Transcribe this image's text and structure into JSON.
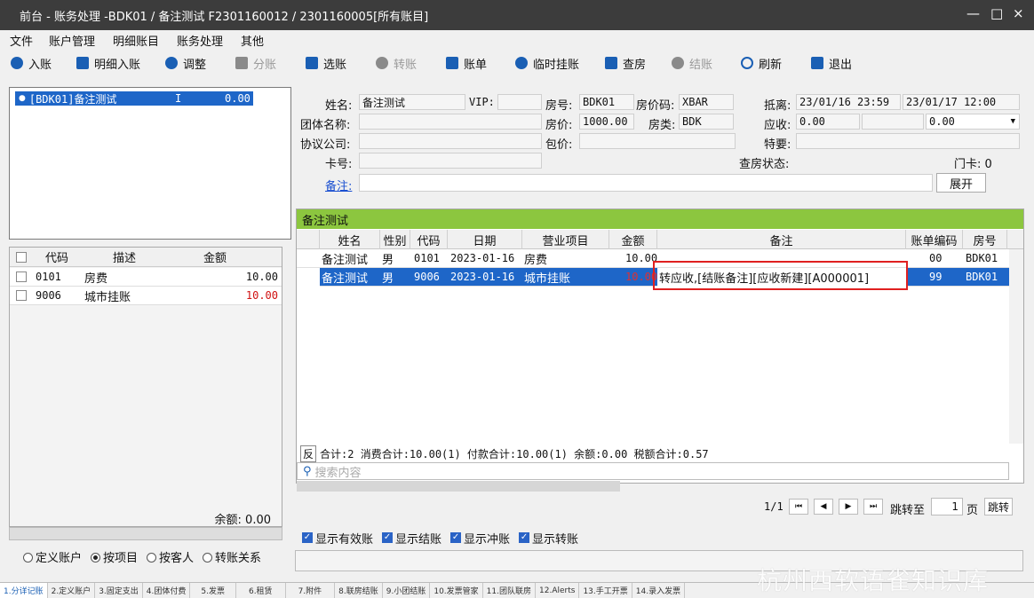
{
  "window": {
    "title": "前台 - 账务处理 -BDK01 / 备注测试 F2301160012 / 2301160005[所有账目]",
    "minimize": "—",
    "maximize": "□",
    "close": "×"
  },
  "menu": [
    "文件",
    "账户管理",
    "明细账目",
    "账务处理",
    "其他"
  ],
  "toolbar": [
    {
      "label": "入账",
      "icon": "yen-circle-icon",
      "enabled": true
    },
    {
      "label": "明细入账",
      "icon": "list-icon",
      "enabled": true
    },
    {
      "label": "调整",
      "icon": "adjust-icon",
      "enabled": true
    },
    {
      "label": "分账",
      "icon": "copy-icon",
      "enabled": false
    },
    {
      "label": "选账",
      "icon": "check-square-icon",
      "enabled": true
    },
    {
      "label": "转账",
      "icon": "transfer-icon",
      "enabled": false
    },
    {
      "label": "账单",
      "icon": "document-icon",
      "enabled": true
    },
    {
      "label": "临时挂账",
      "icon": "clock-icon",
      "enabled": true
    },
    {
      "label": "查房",
      "icon": "house-icon",
      "enabled": true
    },
    {
      "label": "结账",
      "icon": "stack-icon",
      "enabled": false
    },
    {
      "label": "刷新",
      "icon": "refresh-icon",
      "enabled": true
    },
    {
      "label": "退出",
      "icon": "exit-icon",
      "enabled": true
    }
  ],
  "guest_list": {
    "items": [
      {
        "room": "[BDK01]备注测试",
        "status": "I",
        "amount": "0.00"
      }
    ]
  },
  "left_table": {
    "headers": [
      "代码",
      "描述",
      "金额"
    ],
    "rows": [
      {
        "code": "0101",
        "desc": "房费",
        "amount": "10.00",
        "amount_red": false
      },
      {
        "code": "9006",
        "desc": "城市挂账",
        "amount": "10.00",
        "amount_red": true
      }
    ],
    "balance_label": "余额: 0.00"
  },
  "view_mode": {
    "options": [
      "定义账户",
      "按项目",
      "按客人",
      "转账关系"
    ],
    "selected": "按项目"
  },
  "form": {
    "name_label": "姓名:",
    "name_value": "备注测试",
    "vip_label": "VIP:",
    "vip_value": "",
    "room_label": "房号:",
    "room_value": "BDK01",
    "rate_code_label": "房价码:",
    "rate_code_value": "XBAR",
    "arrive_label": "抵离:",
    "arrive_value": "23/01/16 23:59",
    "depart_value": "23/01/17 12:00",
    "group_label": "团体名称:",
    "group_value": "",
    "price_label": "房价:",
    "price_value": "1000.00",
    "room_type_label": "房类:",
    "room_type_value": "BDK",
    "receivable_label": "应收:",
    "receivable_value": "0.00",
    "receivable_mid": "",
    "receivable_select": "0.00",
    "company_label": "协议公司:",
    "company_value": "",
    "package_label": "包价:",
    "package_value": "",
    "special_label": "特要:",
    "special_value": "",
    "card_label": "卡号:",
    "card_value": "",
    "checkroom_label": "查房状态:",
    "doorcard_label": "门卡: 0",
    "remark_label": "备注:",
    "remark_value": "",
    "expand_button": "展开"
  },
  "grid": {
    "caption": "备注测试",
    "headers": [
      "姓名",
      "性别",
      "代码",
      "日期",
      "营业项目",
      "金额",
      "备注",
      "账单编码",
      "房号"
    ],
    "rows": [
      {
        "name": "备注测试",
        "sex": "男",
        "code": "0101",
        "date": "2023-01-16",
        "item": "房费",
        "amount": "10.00",
        "remark": "",
        "bill": "00",
        "room": "BDK01"
      },
      {
        "name": "备注测试",
        "sex": "男",
        "code": "9006",
        "date": "2023-01-16",
        "item": "城市挂账",
        "amount": "10.00",
        "remark": "转应收,[结账备注][应收新建][A000001]",
        "bill": "99",
        "room": "BDK01"
      }
    ],
    "summary_prefix": "反",
    "summary": "合计:2 消费合计:10.00(1) 付款合计:10.00(1) 余额:0.00 税额合计:0.57",
    "search_placeholder": "搜索内容"
  },
  "pager": {
    "page_info": "1/1",
    "jump_label": "跳转至",
    "page_value": "1",
    "page_unit": "页",
    "jump_button": "跳转"
  },
  "filters": [
    {
      "label": "显示有效账",
      "checked": true
    },
    {
      "label": "显示结账",
      "checked": true
    },
    {
      "label": "显示冲账",
      "checked": true
    },
    {
      "label": "显示转账",
      "checked": true
    }
  ],
  "bottom_tabs": [
    "1.分详记账",
    "2.定义账户",
    "3.固定支出",
    "4.团体付费",
    "5.发票",
    "6.租赁",
    "7.附件",
    "8.联房结账",
    "9.小团结账",
    "10.发票管家",
    "11.团队联房",
    "12.Alerts",
    "13.手工开票",
    "14.录入发票"
  ],
  "watermark": "杭州西软语雀知识库"
}
